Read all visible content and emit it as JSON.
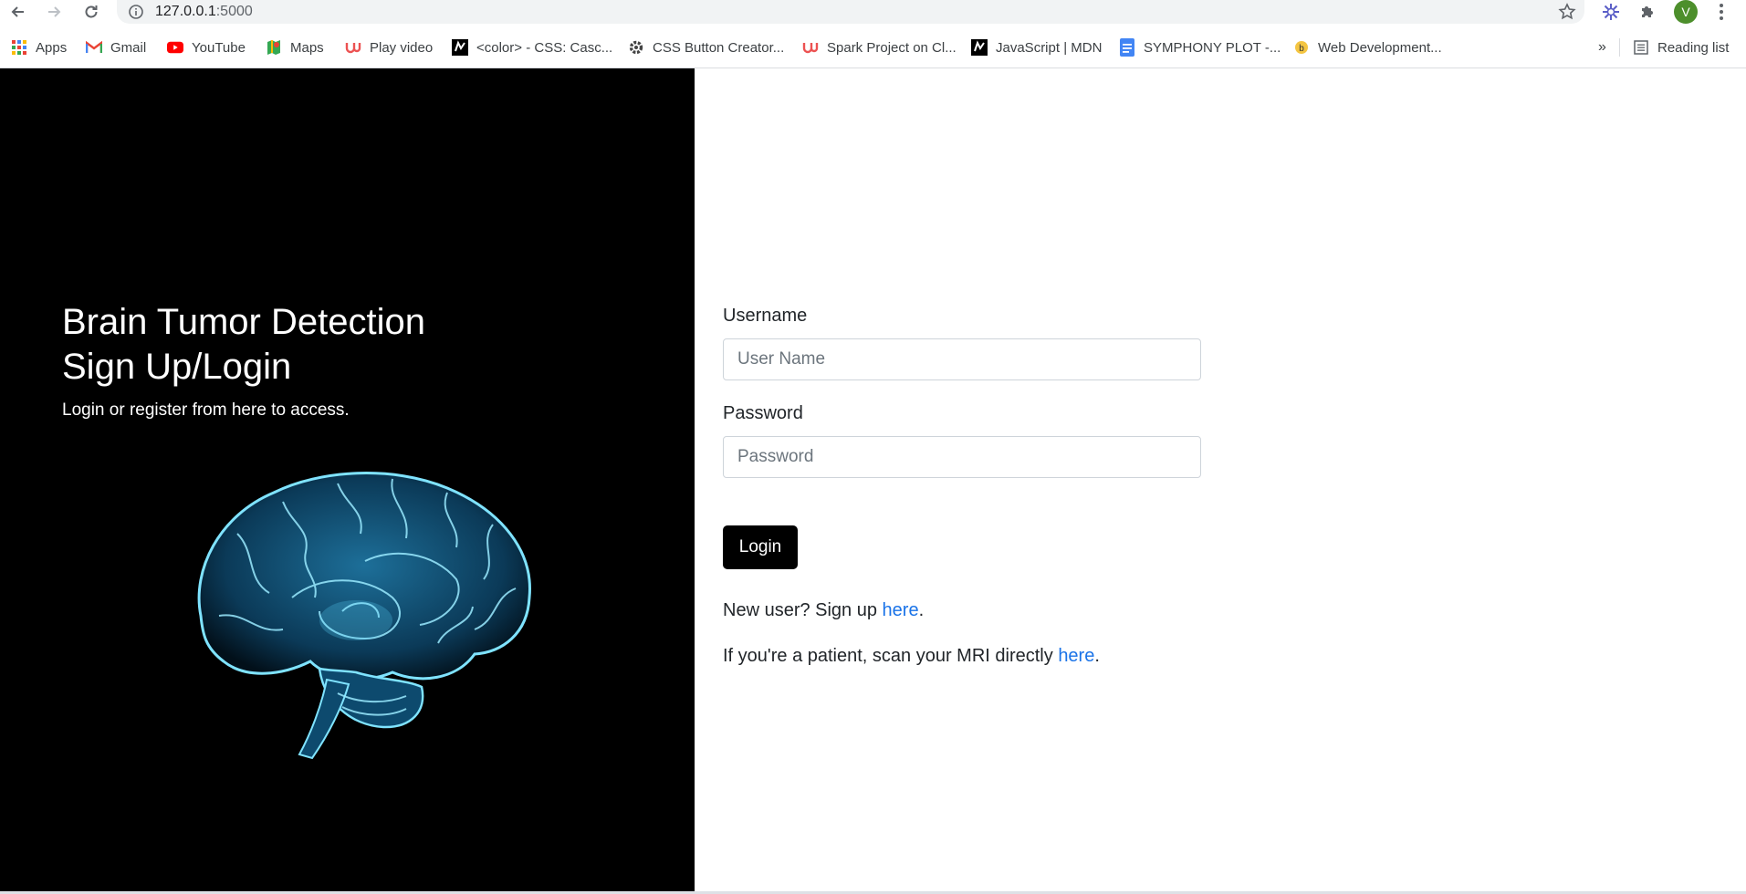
{
  "browser": {
    "url_host": "127.0.0.1",
    "url_port": ":5000",
    "profile_initial": "V",
    "reading_list_label": "Reading list",
    "overflow_label": "»",
    "bookmarks": [
      {
        "label": "Apps",
        "icon": "apps-grid-icon"
      },
      {
        "label": "Gmail",
        "icon": "gmail-icon"
      },
      {
        "label": "YouTube",
        "icon": "youtube-icon"
      },
      {
        "label": "Maps",
        "icon": "maps-icon"
      },
      {
        "label": "Play video",
        "icon": "udemy-icon"
      },
      {
        "label": "<color> - CSS: Casc...",
        "icon": "mdn-icon"
      },
      {
        "label": "CSS Button Creator...",
        "icon": "gear-icon"
      },
      {
        "label": "Spark Project on Cl...",
        "icon": "udemy-icon"
      },
      {
        "label": "JavaScript | MDN",
        "icon": "mdn-icon"
      },
      {
        "label": "SYMPHONY PLOT -...",
        "icon": "google-docs-icon"
      },
      {
        "label": "Web Development...",
        "icon": "web-dev-icon"
      }
    ]
  },
  "hero": {
    "title_line1": "Brain Tumor Detection",
    "title_line2": "Sign Up/Login",
    "subtitle": "Login or register from here to access."
  },
  "form": {
    "username_label": "Username",
    "username_placeholder": "User Name",
    "password_label": "Password",
    "password_placeholder": "Password",
    "login_label": "Login",
    "signup_prefix": "New user? Sign up ",
    "signup_link": "here",
    "signup_suffix": ".",
    "patient_prefix": "If you're a patient, scan your MRI directly ",
    "patient_link": "here",
    "patient_suffix": "."
  },
  "colors": {
    "hero_bg": "#000000",
    "link": "#1a73e8",
    "button_bg": "#000000",
    "brain_glow": "#5ad7ff"
  }
}
